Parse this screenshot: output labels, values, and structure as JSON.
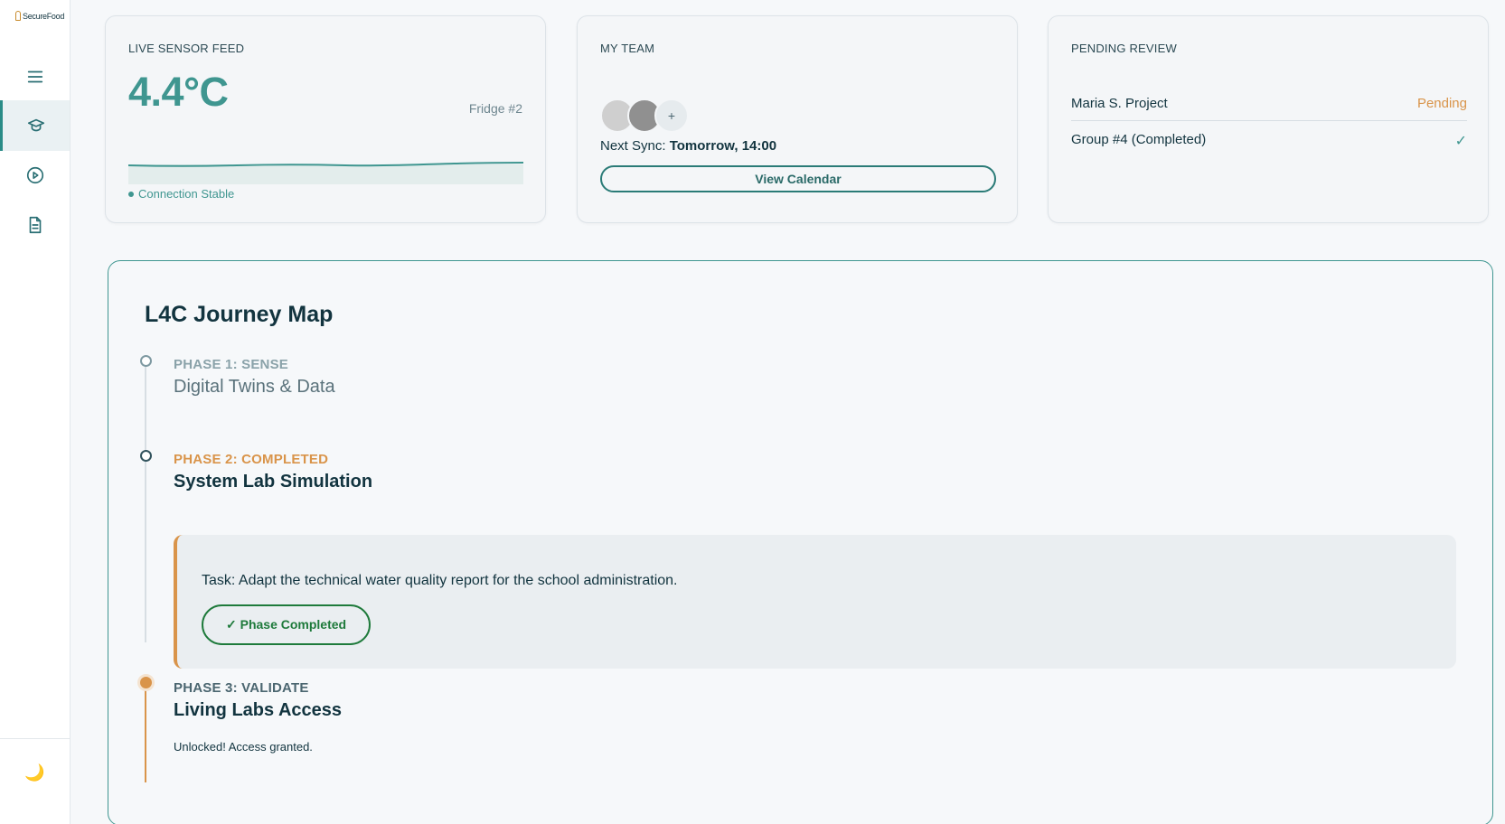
{
  "app": {
    "logo_text": "SecureFood"
  },
  "sidebar": {
    "items": [
      {
        "icon": "menu-icon"
      },
      {
        "icon": "graduation-cap-icon",
        "active": true
      },
      {
        "icon": "play-circle-icon"
      },
      {
        "icon": "document-icon"
      }
    ],
    "theme_icon": "moon-icon",
    "theme_glyph": "🌙"
  },
  "sensor": {
    "title": "LIVE SENSOR FEED",
    "temperature": "4.4°C",
    "location": "Fridge #2",
    "status": "Connection Stable"
  },
  "team": {
    "title": "MY TEAM",
    "add_label": "+",
    "next_sync_label": "Next Sync:",
    "next_sync_value": "Tomorrow, 14:00",
    "view_calendar_label": "View Calendar"
  },
  "pending": {
    "title": "PENDING REVIEW",
    "items": [
      {
        "name": "Maria S. Project",
        "status": "Pending"
      },
      {
        "name": "Group #4 (Completed)",
        "status": "✓"
      }
    ]
  },
  "journey": {
    "title": "L4C Journey Map",
    "phases": [
      {
        "label": "PHASE 1: SENSE",
        "name": "Digital Twins & Data"
      },
      {
        "label": "PHASE 2: COMPLETED",
        "name": "System Lab Simulation"
      },
      {
        "label": "PHASE 3: VALIDATE",
        "name": "Living Labs Access"
      }
    ],
    "task": {
      "text": "Task: Adapt the technical water quality report for the school administration.",
      "button_label": "✓ Phase Completed"
    },
    "unlocked_text": "Unlocked! Access granted."
  },
  "colors": {
    "accent_teal": "#3f9690",
    "accent_orange": "#d9944a",
    "success_green": "#1e7a3b"
  }
}
